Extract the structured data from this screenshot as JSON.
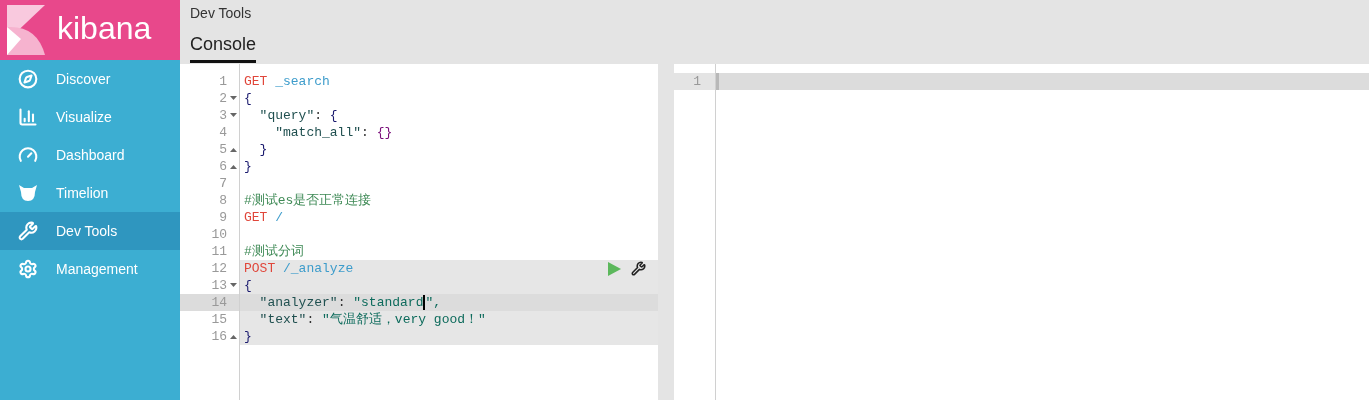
{
  "logo": {
    "text": "kibana"
  },
  "sidebar": {
    "items": [
      {
        "label": "Discover",
        "kind": "compass",
        "selected": false
      },
      {
        "label": "Visualize",
        "kind": "chart",
        "selected": false
      },
      {
        "label": "Dashboard",
        "kind": "gauge",
        "selected": false
      },
      {
        "label": "Timelion",
        "kind": "bear",
        "selected": false
      },
      {
        "label": "Dev Tools",
        "kind": "wrench",
        "selected": true
      },
      {
        "label": "Management",
        "kind": "gear",
        "selected": false
      }
    ]
  },
  "header": {
    "title": "Dev Tools",
    "tabs": [
      {
        "label": "Console",
        "selected": true
      }
    ]
  },
  "editor": {
    "lines": [
      {
        "number": "1",
        "fold_open": false,
        "fold_close": false,
        "request": false,
        "active": false,
        "tokens": [
          {
            "kind": "method",
            "text": "GET"
          },
          {
            "kind": "path",
            "text": " _search"
          }
        ]
      },
      {
        "number": "2",
        "fold_open": true,
        "fold_close": false,
        "request": false,
        "active": false,
        "tokens": [
          {
            "kind": "brace",
            "text": "{"
          }
        ]
      },
      {
        "number": "3",
        "fold_open": true,
        "fold_close": false,
        "request": false,
        "active": false,
        "tokens": [
          {
            "kind": "key",
            "text": "  \"query\""
          },
          {
            "kind": "plain",
            "text": ": "
          },
          {
            "kind": "brace",
            "text": "{"
          }
        ]
      },
      {
        "number": "4",
        "fold_open": false,
        "fold_close": false,
        "request": false,
        "active": false,
        "tokens": [
          {
            "kind": "key",
            "text": "    \"match_all\""
          },
          {
            "kind": "plain",
            "text": ": "
          },
          {
            "kind": "paren",
            "text": "{}"
          }
        ]
      },
      {
        "number": "5",
        "fold_open": false,
        "fold_close": true,
        "request": false,
        "active": false,
        "tokens": [
          {
            "kind": "brace",
            "text": "  }"
          }
        ]
      },
      {
        "number": "6",
        "fold_open": false,
        "fold_close": true,
        "request": false,
        "active": false,
        "tokens": [
          {
            "kind": "brace",
            "text": "}"
          }
        ]
      },
      {
        "number": "7",
        "fold_open": false,
        "fold_close": false,
        "request": false,
        "active": false
      },
      {
        "number": "8",
        "fold_open": false,
        "fold_close": false,
        "request": false,
        "active": false,
        "tokens": [
          {
            "kind": "comment",
            "text": "#测试es是否正常连接"
          }
        ]
      },
      {
        "number": "9",
        "fold_open": false,
        "fold_close": false,
        "request": false,
        "active": false,
        "tokens": [
          {
            "kind": "method",
            "text": "GET"
          },
          {
            "kind": "path",
            "text": " /"
          }
        ]
      },
      {
        "number": "10",
        "fold_open": false,
        "fold_close": false,
        "request": false,
        "active": false
      },
      {
        "number": "11",
        "fold_open": false,
        "fold_close": false,
        "request": false,
        "active": false,
        "tokens": [
          {
            "kind": "comment",
            "text": "#测试分词"
          }
        ]
      },
      {
        "number": "12",
        "fold_open": false,
        "fold_close": false,
        "request": true,
        "active": false,
        "actions": true,
        "tokens": [
          {
            "kind": "method",
            "text": "POST"
          },
          {
            "kind": "path",
            "text": " /_analyze"
          }
        ]
      },
      {
        "number": "13",
        "fold_open": true,
        "fold_close": false,
        "request": true,
        "active": false,
        "tokens": [
          {
            "kind": "brace",
            "text": "{"
          }
        ]
      },
      {
        "number": "14",
        "fold_open": false,
        "fold_close": false,
        "request": true,
        "active": true,
        "tokens": [
          {
            "kind": "key",
            "text": "  \"analyzer\""
          },
          {
            "kind": "plain",
            "text": ": "
          },
          {
            "kind": "string",
            "text": "\"standard",
            "cursor_after": true
          },
          {
            "kind": "string",
            "text": "\","
          }
        ]
      },
      {
        "number": "15",
        "fold_open": false,
        "fold_close": false,
        "request": true,
        "active": false,
        "tokens": [
          {
            "kind": "key",
            "text": "  \"text\""
          },
          {
            "kind": "plain",
            "text": ": "
          },
          {
            "kind": "string",
            "text": "\"气温舒适，very good！\""
          }
        ]
      },
      {
        "number": "16",
        "fold_open": false,
        "fold_close": true,
        "request": true,
        "active": false,
        "tokens": [
          {
            "kind": "brace",
            "text": "}"
          }
        ]
      }
    ]
  },
  "output": {
    "lines": [
      {
        "number": "1",
        "active": true
      }
    ]
  }
}
